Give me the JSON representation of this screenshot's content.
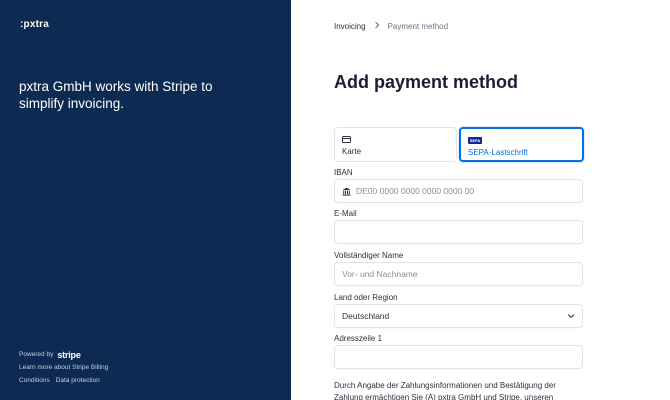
{
  "brand": {
    "logo_text": ":pxtra",
    "tagline": "pxtra GmbH works with Stripe to simplify invoicing."
  },
  "footer": {
    "powered_by": "Powered by",
    "stripe": "stripe",
    "learn_more": "Learn more about Stripe Billing",
    "conditions": "Conditions",
    "data_protection": "Data protection"
  },
  "breadcrumb": {
    "first": "Invoicing",
    "current": "Payment method"
  },
  "page_title": "Add payment method",
  "tabs": [
    {
      "label": "Karte",
      "icon": "card-icon",
      "selected": false
    },
    {
      "label": "SEPA-Lastschrift",
      "icon": "sepa-icon",
      "icon_text": "SEPA",
      "selected": true
    }
  ],
  "form": {
    "iban": {
      "label": "IBAN",
      "placeholder": "DE00 0000 0000 0000 0000 00"
    },
    "email": {
      "label": "E-Mail",
      "placeholder": ""
    },
    "name": {
      "label": "Vollständiger Name",
      "placeholder": "Vor- und Nachname"
    },
    "country": {
      "label": "Land oder Region",
      "value": "Deutschland"
    },
    "address1": {
      "label": "Adresszeile 1",
      "placeholder": ""
    }
  },
  "legal_text": "Durch Angabe der Zahlungsinformationen und Bestätigung der Zahlung ermächtigen Sie (A) pxtra GmbH und Stripe, unseren",
  "colors": {
    "sidebar": "#0d2a52",
    "accent": "#0570de"
  }
}
